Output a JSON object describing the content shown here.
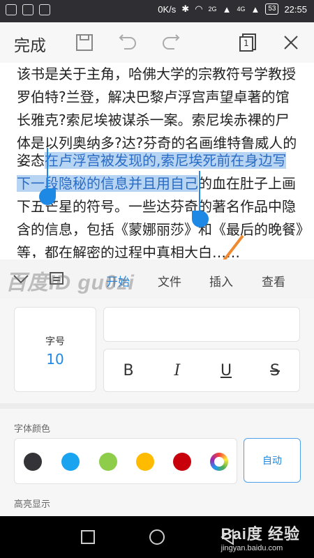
{
  "status_bar": {
    "network_speed": "0K/s",
    "signal_2g": "2G",
    "signal_4g": "4G",
    "battery": "53",
    "time": "22:55"
  },
  "toolbar": {
    "done_label": "完成",
    "icons": [
      "save-icon",
      "undo-icon",
      "redo-icon",
      "page-count-icon",
      "close-icon"
    ],
    "page_count": "1"
  },
  "document": {
    "line1": "该书是关于主角，哈佛大学的宗教符号学教授",
    "line2": "罗伯特?兰登，解决巴黎卢浮宫声望卓著的馆",
    "line3": "长雅克?索尼埃被谋杀一案。索尼埃赤裸的尸",
    "line4": "体是以列奥纳多?达?芬奇的名画维特鲁威人的",
    "line5_plain": "姿态",
    "line5_highlight": "在卢浮宫被发现的,索尼埃死前在身边写",
    "line6_highlight": "下一段隐秘的信息并且用自己",
    "line6_plain": "的血在肚子上画",
    "line7": "下五芒星的符号。一些达芬奇的著名作品中隐",
    "line8": "含的信息，包括《蒙娜丽莎》和《最后的晚餐》",
    "line9": "等，都在解密的过程中真相大白……"
  },
  "tabs": {
    "start": "开始",
    "file": "文件",
    "insert": "插入",
    "view": "查看"
  },
  "watermark": "百度ID gu0zi",
  "format_panel": {
    "font_size_label": "字号",
    "font_size_value": "10",
    "bold": "B",
    "italic": "I",
    "underline": "U",
    "strike": "S",
    "font_color_label": "字体颜色",
    "auto_label": "自动",
    "highlight_label": "高亮显示",
    "colors": [
      "#333338",
      "#1aa3ee",
      "#8dcd4a",
      "#ffbb00",
      "#c7000b"
    ]
  },
  "nav_brand": {
    "main": "Bai度 经验",
    "sub": "jingyan.baidu.com"
  }
}
